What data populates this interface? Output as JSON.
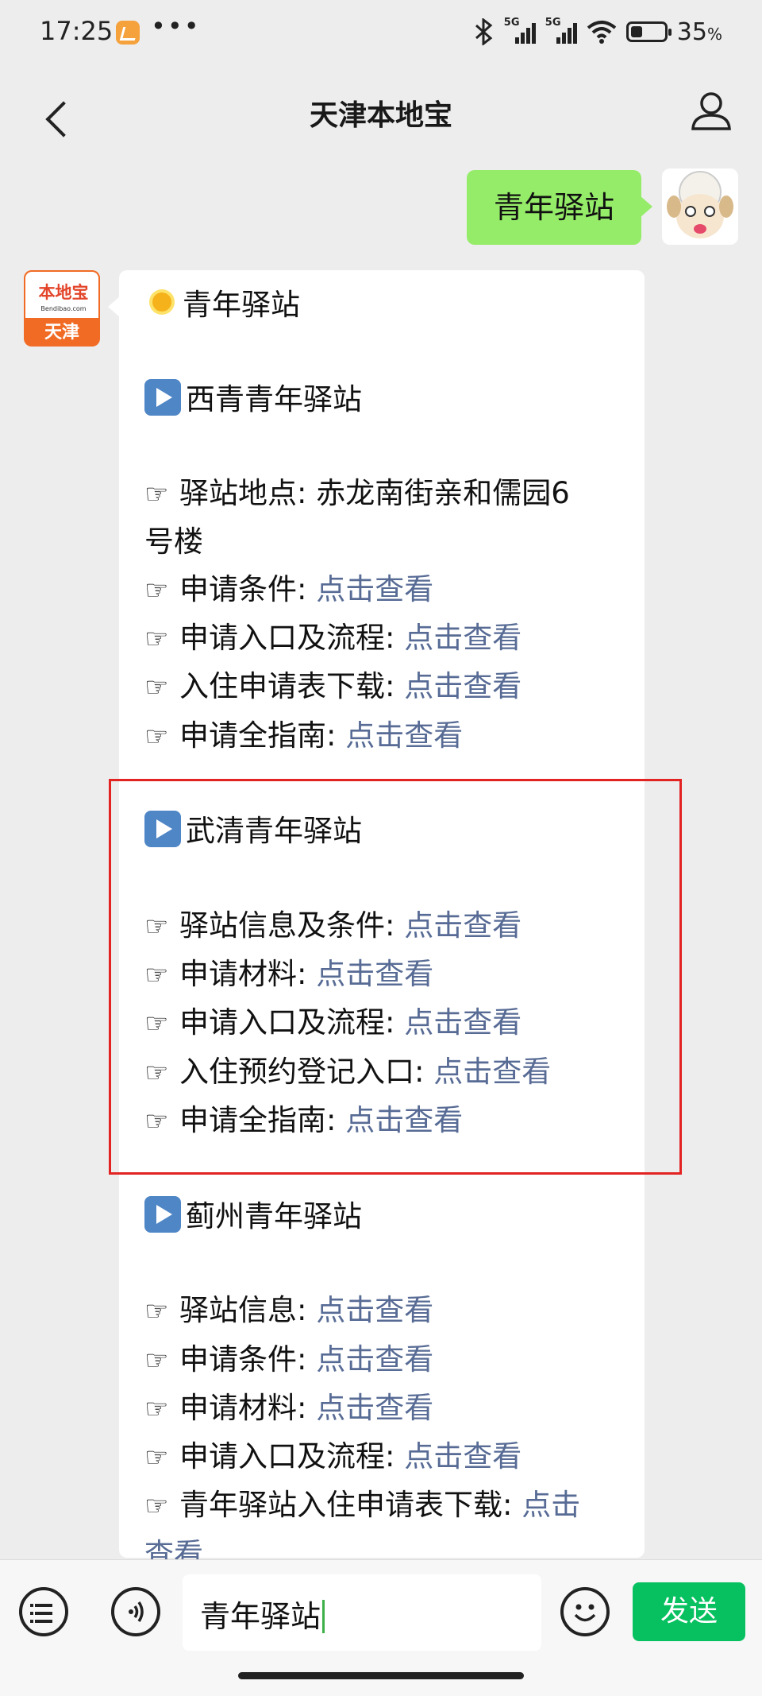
{
  "status_bar": {
    "time": "17:25",
    "dots": "•••",
    "network_label": "5G",
    "battery_percent": "35",
    "battery_unit": "%",
    "battery_level": 0.35,
    "icons": [
      "app-notification-icon",
      "bluetooth-icon",
      "signal-icon",
      "wifi-icon",
      "battery-icon"
    ]
  },
  "header": {
    "title": "天津本地宝",
    "back_icon": "chevron-left-icon",
    "profile_icon": "person-icon"
  },
  "chat": {
    "sent_message": "青年驿站",
    "bot_avatar": {
      "brand": "本地宝",
      "url": "Bendibao.com",
      "city": "天津"
    },
    "reply": {
      "heading": "青年驿站",
      "sections": [
        {
          "title": "西青青年驿站",
          "items": [
            {
              "label": "驿站地点: 赤龙南街亲和儒园6",
              "label_cont": "号楼"
            },
            {
              "label": "申请条件: ",
              "link": "点击查看"
            },
            {
              "label": "申请入口及流程: ",
              "link": "点击查看"
            },
            {
              "label": "入住申请表下载: ",
              "link": "点击查看"
            },
            {
              "label": "申请全指南: ",
              "link": "点击查看"
            }
          ]
        },
        {
          "title": "武清青年驿站",
          "items": [
            {
              "label": "驿站信息及条件: ",
              "link": "点击查看"
            },
            {
              "label": "申请材料: ",
              "link": "点击查看"
            },
            {
              "label": "申请入口及流程: ",
              "link": "点击查看"
            },
            {
              "label": "入住预约登记入口: ",
              "link": "点击查看"
            },
            {
              "label": "申请全指南: ",
              "link": "点击查看"
            }
          ]
        },
        {
          "title": "蓟州青年驿站",
          "items": [
            {
              "label": "驿站信息: ",
              "link": "点击查看"
            },
            {
              "label": "申请条件: ",
              "link": "点击查看"
            },
            {
              "label": "申请材料: ",
              "link": "点击查看"
            },
            {
              "label": "申请入口及流程: ",
              "link": "点击查看"
            },
            {
              "label": "青年驿站入住申请表下载: ",
              "link": "点击",
              "link_cont": "查看"
            }
          ]
        }
      ]
    }
  },
  "input_bar": {
    "value": "青年驿站",
    "send_label": "发送",
    "icons": [
      "menu-list-icon",
      "voice-icon",
      "emoji-icon"
    ]
  },
  "colors": {
    "background": "#ededed",
    "sent_bubble": "#95ec69",
    "link": "#576b95",
    "send_button": "#07c160",
    "highlight": "#e32222"
  }
}
